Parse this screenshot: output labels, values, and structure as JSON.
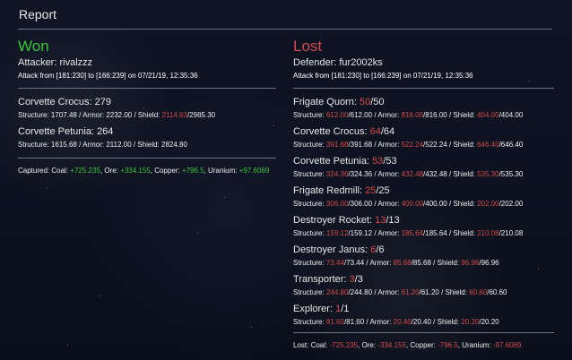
{
  "header": {
    "title": "Report"
  },
  "winner": {
    "result": "Won",
    "party_label": "Attacker:",
    "party_name": "rivalzzz",
    "attack_text": "Attack from [181:230] to [166:239] on 07/21/19, 12:35:36",
    "ships": [
      {
        "name": "Corvette Crocus:",
        "count": "279",
        "structure": "1707.48",
        "armor": "2232.00",
        "shield_current": "2114.63",
        "shield_max": "2985.30"
      },
      {
        "name": "Corvette Petunia:",
        "count": "264",
        "structure": "1615.68",
        "armor": "2112.00",
        "shield_full": "2824.80"
      }
    ],
    "resources": {
      "label": "Captured:",
      "coal_label": "Coal:",
      "coal": "+725.235",
      "ore_label": "Ore:",
      "ore": "+334.155",
      "copper_label": "Copper:",
      "copper": "+796.5",
      "uranium_label": "Uranium:",
      "uranium": "+97.6069"
    }
  },
  "loser": {
    "result": "Lost",
    "party_label": "Defender:",
    "party_name": "fur2002ks",
    "attack_text": "Attack from [181:230] to [166:239] on 07/21/19, 12:35:36",
    "ships": [
      {
        "name": "Frigate Quorn:",
        "lost": "50",
        "total": "/50",
        "structure_lost": "612.00",
        "structure_total": "/612.00",
        "armor_lost": "816.00",
        "armor_total": "/816.00",
        "shield_lost": "404.00",
        "shield_total": "/404.00"
      },
      {
        "name": "Corvette Crocus:",
        "lost": "64",
        "total": "/64",
        "structure_lost": "391.68",
        "structure_total": "/391.68",
        "armor_lost": "522.24",
        "armor_total": "/522.24",
        "shield_lost": "646.40",
        "shield_total": "/646.40"
      },
      {
        "name": "Corvette Petunia:",
        "lost": "53",
        "total": "/53",
        "structure_lost": "324.36",
        "structure_total": "/324.36",
        "armor_lost": "432.48",
        "armor_total": "/432.48",
        "shield_lost": "535.30",
        "shield_total": "/535.30"
      },
      {
        "name": "Frigate Redmill:",
        "lost": "25",
        "total": "/25",
        "structure_lost": "306.00",
        "structure_total": "/306.00",
        "armor_lost": "400.00",
        "armor_total": "/400.00",
        "shield_lost": "202.00",
        "shield_total": "/202.00"
      },
      {
        "name": "Destroyer Rocket:",
        "lost": "13",
        "total": "/13",
        "structure_lost": "159.12",
        "structure_total": "/159.12",
        "armor_lost": "185.64",
        "armor_total": "/185.64",
        "shield_lost": "210.08",
        "shield_total": "/210.08"
      },
      {
        "name": "Destroyer Janus:",
        "lost": "6",
        "total": "/6",
        "structure_lost": "73.44",
        "structure_total": "/73.44",
        "armor_lost": "85.68",
        "armor_total": "/85.68",
        "shield_lost": "96.96",
        "shield_total": "/96.96"
      },
      {
        "name": "Transporter:",
        "lost": "3",
        "total": "/3",
        "structure_lost": "244.80",
        "structure_total": "/244.80",
        "armor_lost": "61.20",
        "armor_total": "/61.20",
        "shield_lost": "60.60",
        "shield_total": "/60.60"
      },
      {
        "name": "Explorer:",
        "lost": "1",
        "total": "/1",
        "structure_lost": "81.60",
        "structure_total": "/81.60",
        "armor_lost": "20.40",
        "armor_total": "/20.40",
        "shield_lost": "20.20",
        "shield_total": "/20.20"
      }
    ],
    "resources": {
      "label": "Lost:",
      "coal_label": "Coal:",
      "coal": "-725.235",
      "ore_label": "Ore:",
      "ore": "-334.155",
      "copper_label": "Copper:",
      "copper": "-796.5",
      "uranium_label": "Uranium:",
      "uranium": "-97.6069"
    }
  },
  "labels": {
    "structure": "Structure:",
    "armor": "Armor:",
    "shield": "Shield:",
    "sep": " / "
  },
  "colors": {
    "win": "#39c53a",
    "loss": "#d24a4a",
    "background": "#0e1220"
  }
}
